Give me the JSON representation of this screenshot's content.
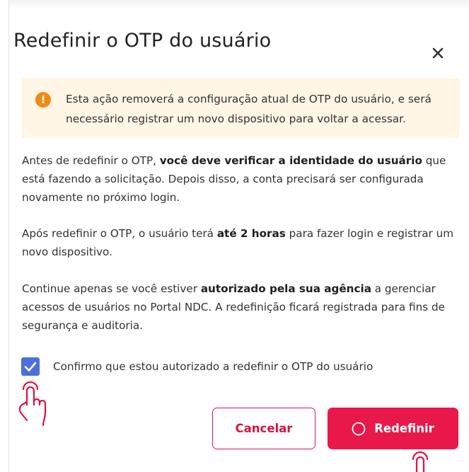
{
  "dialog": {
    "title": "Redefinir o OTP do usuário",
    "close_icon": "close-icon"
  },
  "warning": {
    "icon": "exclamation-icon",
    "text": "Esta ação removerá a configuração atual de OTP do usuário, e será necessário registrar um novo dispositivo para voltar a acessar."
  },
  "body": {
    "p1": {
      "before": "Antes de redefinir o OTP, ",
      "bold": "você deve verificar a identidade do usuário",
      "after": " que está fazendo a solicitação. Depois disso, a conta precisará ser configurada novamente no próximo login."
    },
    "p2": {
      "before": "Após redefinir o OTP, o usuário terá ",
      "bold": "até 2 horas",
      "after": " para fazer login e registrar um novo dispositivo."
    },
    "p3": {
      "before": "Continue apenas se você estiver ",
      "bold": "autorizado pela sua agência",
      "after": " a gerenciar acessos de usuários no Portal NDC. A redefinição ficará registrada para fins de segurança e auditoria."
    }
  },
  "confirm": {
    "checked": true,
    "label": "Confirmo que estou autorizado a redefinir o OTP do usuário"
  },
  "actions": {
    "cancel_label": "Cancelar",
    "reset_label": "Redefinir",
    "reset_icon": "spinner-icon"
  },
  "colors": {
    "accent": "#e8194a",
    "checkbox": "#4c6fdb",
    "warning_bg": "#fff6e6",
    "warning_icon": "#f08a15"
  }
}
